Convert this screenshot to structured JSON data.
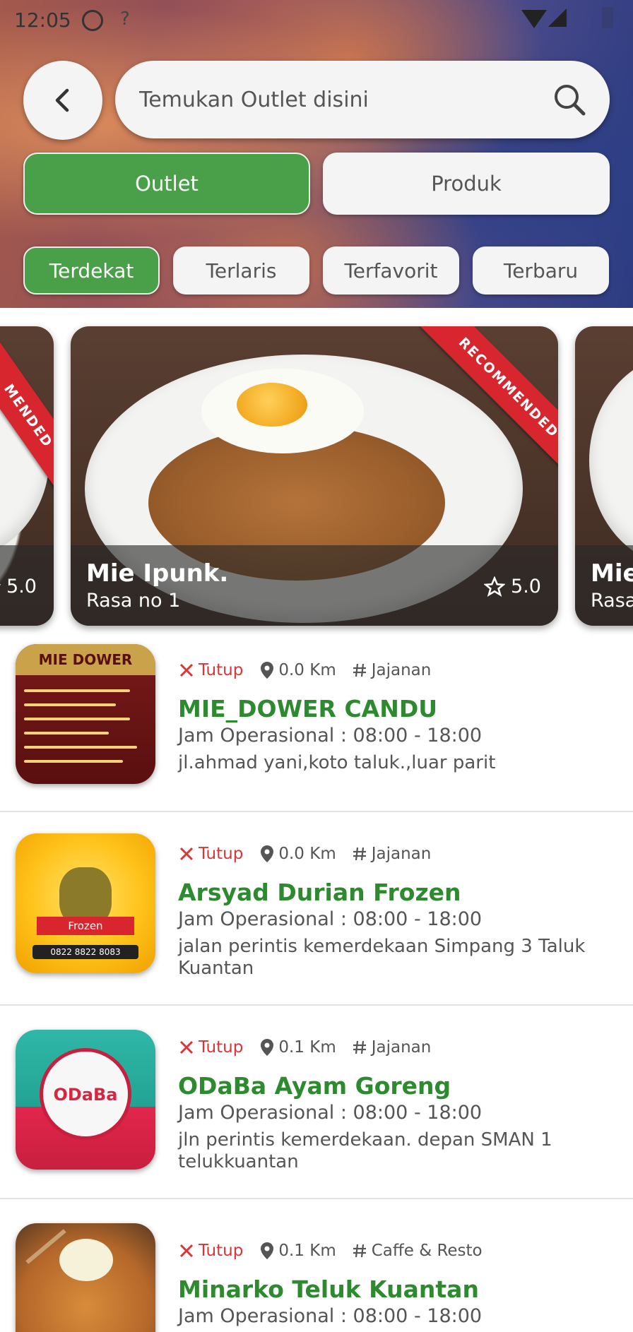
{
  "status_bar": {
    "time": "12:05"
  },
  "search": {
    "placeholder": "Temukan Outlet disini"
  },
  "segments": {
    "outlet": "Outlet",
    "produk": "Produk"
  },
  "filters": [
    "Terdekat",
    "Terlaris",
    "Terfavorit",
    "Terbaru"
  ],
  "carousel": {
    "ribbon_text": "RECOMMENDED",
    "left_partial": {
      "ribbon": "MENDED",
      "rating": "5.0"
    },
    "main": {
      "title": "Mie Ipunk.",
      "subtitle": "Rasa no 1",
      "rating": "5.0"
    },
    "right_partial": {
      "title": "Mie",
      "subtitle": "Rasa"
    }
  },
  "outlets": [
    {
      "status": "Tutup",
      "distance": "0.0 Km",
      "category": "Jajanan",
      "name": "MIE_DOWER CANDU",
      "hours": "Jam Operasional : 08:00 - 18:00",
      "address": "jl.ahmad yani,koto taluk.,luar parit",
      "thumb_text": "MIE DOWER"
    },
    {
      "status": "Tutup",
      "distance": "0.0 Km",
      "category": "Jajanan",
      "name": "Arsyad Durian Frozen",
      "hours": "Jam Operasional : 08:00 - 18:00",
      "address": "jalan perintis kemerdekaan Simpang 3 Taluk Kuantan",
      "thumb_text": "Frozen",
      "thumb_phone": "0822 8822 8083"
    },
    {
      "status": "Tutup",
      "distance": "0.1 Km",
      "category": "Jajanan",
      "name": "ODaBa Ayam Goreng",
      "hours": "Jam Operasional : 08:00 - 18:00",
      "address": "jln perintis kemerdekaan. depan SMAN 1 telukkuantan",
      "thumb_text": "ODaBa"
    },
    {
      "status": "Tutup",
      "distance": "0.1 Km",
      "category": "Caffe & Resto",
      "name": "Minarko Teluk Kuantan",
      "hours": "Jam Operasional : 08:00 - 18:00"
    }
  ],
  "colors": {
    "accent_green": "#4aa048",
    "name_green": "#2e8a2e",
    "closed_red": "#d93636",
    "ribbon_red": "#d7262e"
  }
}
